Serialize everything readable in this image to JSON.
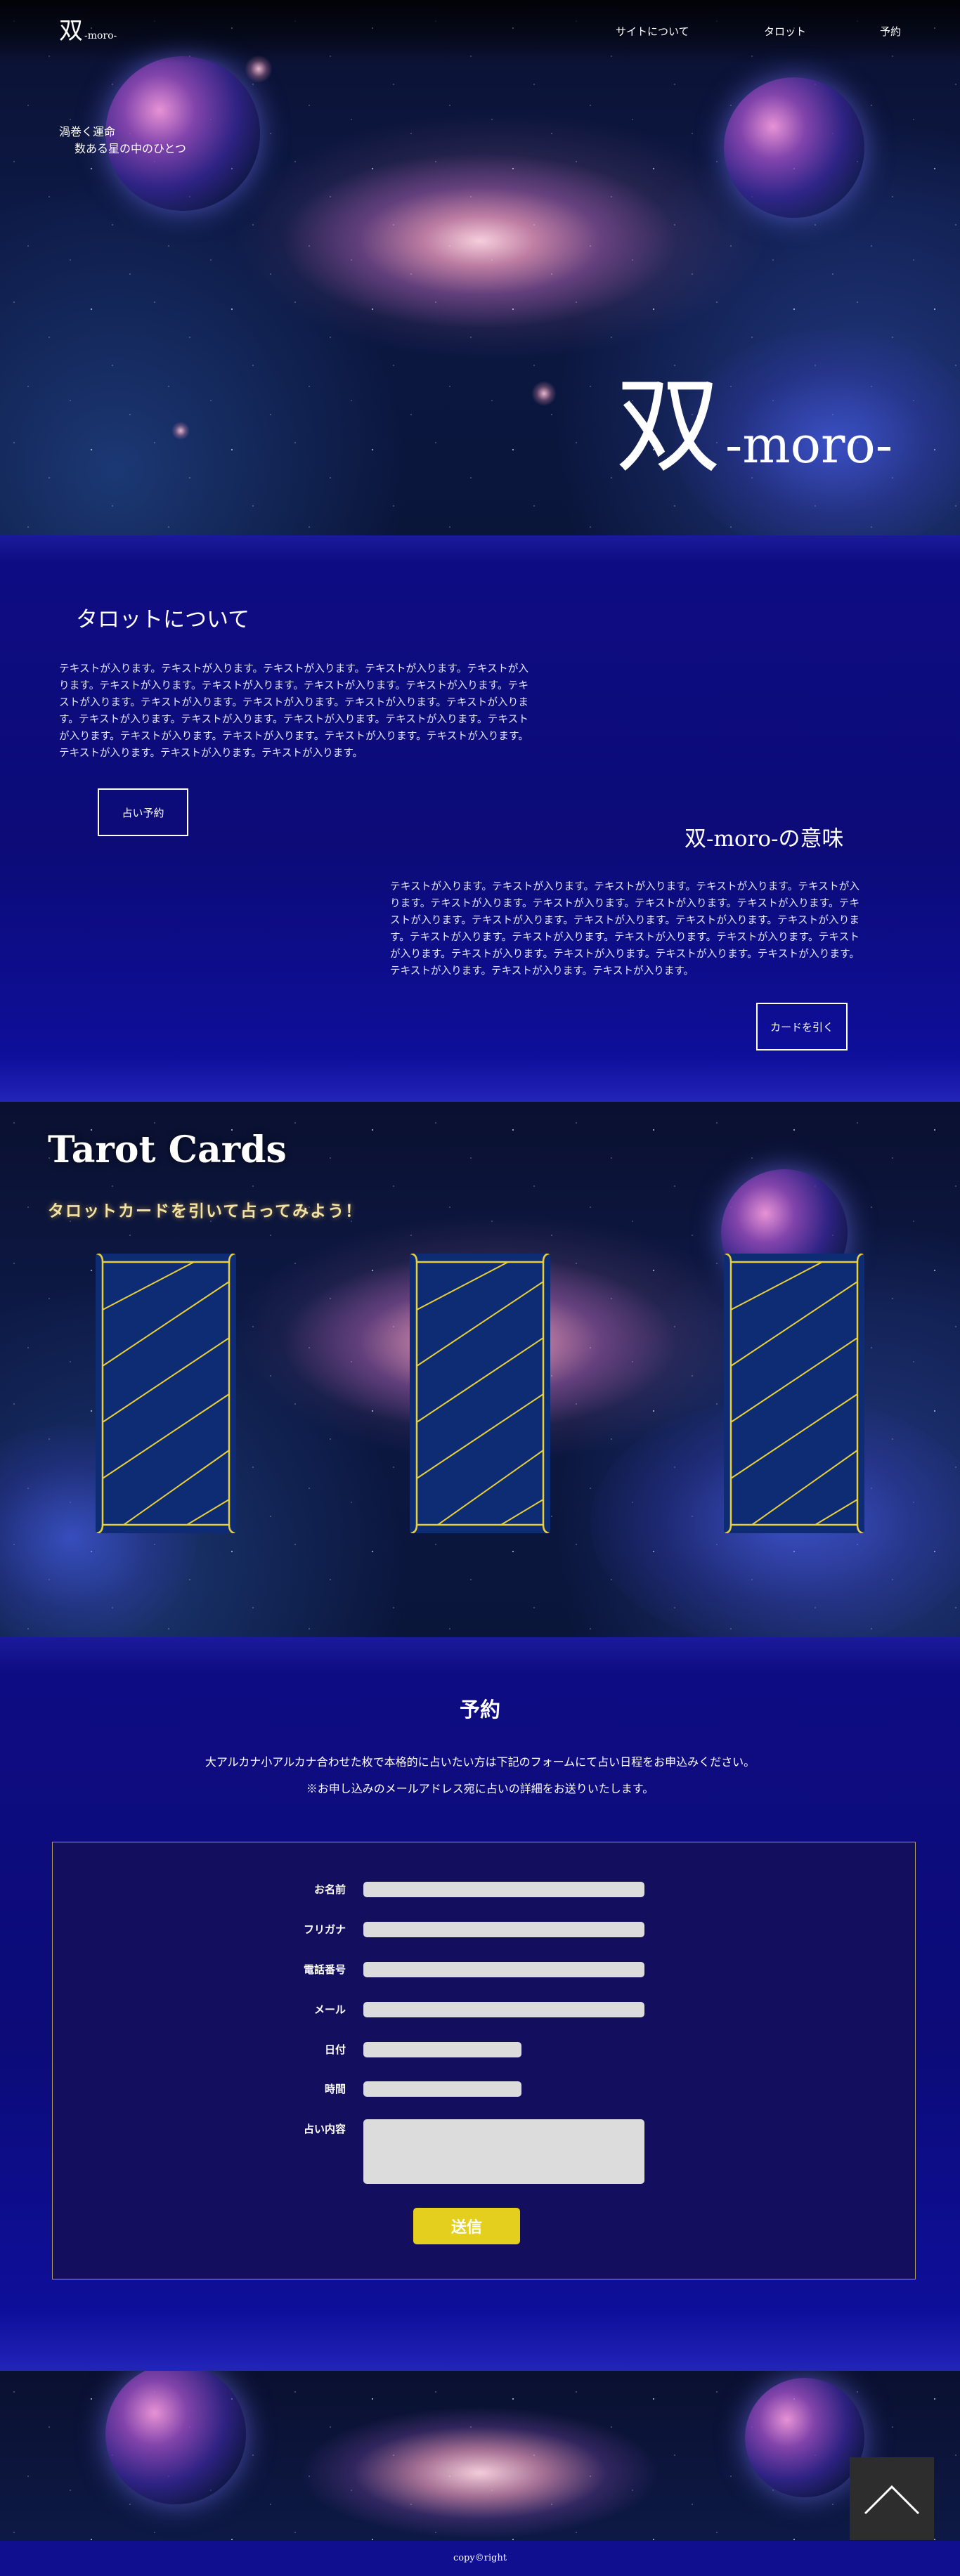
{
  "header": {
    "logo_main": "双",
    "logo_sub": "-moro-",
    "nav": [
      "サイトについて",
      "タロット",
      "予約"
    ]
  },
  "hero": {
    "tagline_1": "渦巻く運命",
    "tagline_2": "数ある星の中のひとつ",
    "title_main": "双",
    "title_sub": "-moro-"
  },
  "about": {
    "heading": "タロットについて",
    "body": "テキストが入ります。テキストが入ります。テキストが入ります。テキストが入ります。テキストが入ります。テキストが入ります。テキストが入ります。テキストが入ります。テキストが入ります。テキストが入ります。テキストが入ります。テキストが入ります。テキストが入ります。テキストが入ります。テキストが入ります。テキストが入ります。テキストが入ります。テキストが入ります。テキストが入ります。テキストが入ります。テキストが入ります。テキストが入ります。テキストが入ります。テキストが入ります。テキストが入ります。テキストが入ります。",
    "button": "占い予約"
  },
  "meaning": {
    "heading": "双-moro-の意味",
    "body": "テキストが入ります。テキストが入ります。テキストが入ります。テキストが入ります。テキストが入ります。テキストが入ります。テキストが入ります。テキストが入ります。テキストが入ります。テキストが入ります。テキストが入ります。テキストが入ります。テキストが入ります。テキストが入ります。テキストが入ります。テキストが入ります。テキストが入ります。テキストが入ります。テキストが入ります。テキストが入ります。テキストが入ります。テキストが入ります。テキストが入ります。テキストが入ります。テキストが入ります。テキストが入ります。",
    "button": "カードを引く"
  },
  "tarot": {
    "title": "Tarot Cards",
    "subtitle": "タロットカードを引いて占ってみよう！",
    "card_color": "#0d2c73",
    "card_line_color": "#e9cf3a"
  },
  "reservation": {
    "title": "予約",
    "line_1": "大アルカナ小アルカナ合わせた枚で本格的に占いたい方は下記のフォームにて占い日程をお申込みください。",
    "line_2": "※お申し込みのメールアドレス宛に占いの詳細をお送りいたします。",
    "labels": {
      "name": "お名前",
      "furigana": "フリガナ",
      "phone": "電話番号",
      "email": "メール",
      "date": "日付",
      "time": "時間",
      "content": "占い内容"
    },
    "submit": "送信",
    "submit_color": "#e4cf1e"
  },
  "footer": {
    "copyright": "copy©right",
    "pagetop_icon": "chevron-up-icon"
  }
}
